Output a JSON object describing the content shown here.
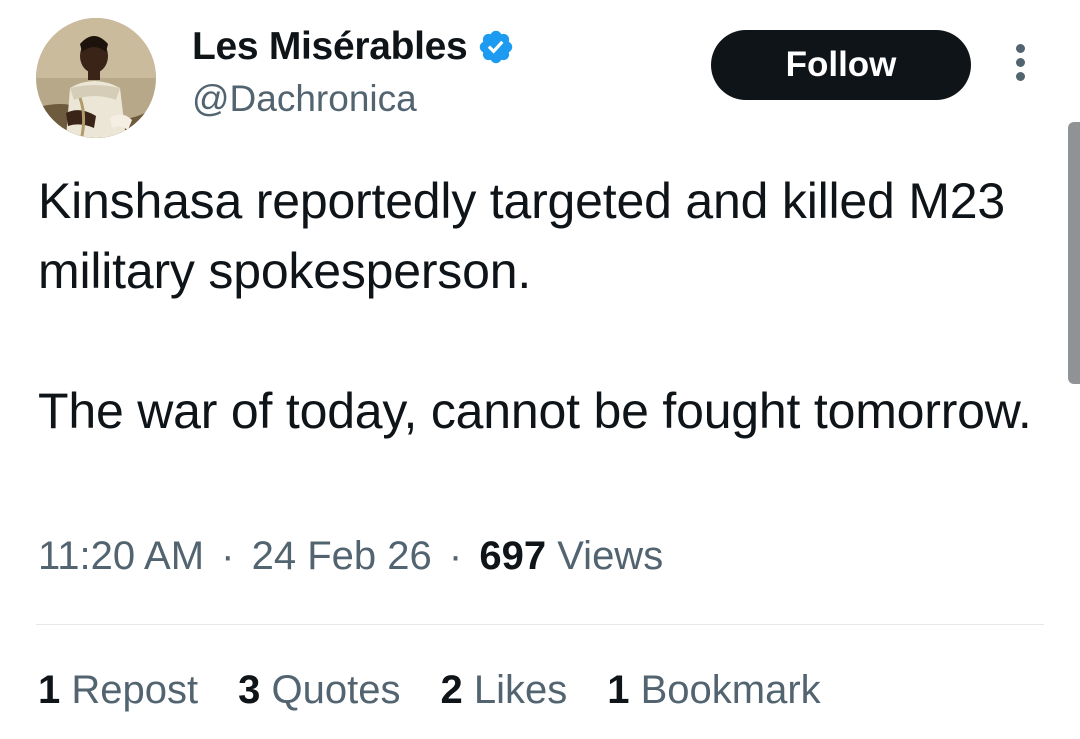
{
  "author": {
    "display_name": "Les Misérables",
    "handle": "@Dachronica",
    "avatar": "portrait-painting-avatar",
    "verified_icon": "verified-badge-icon",
    "verified_color": "#1d9bf0"
  },
  "actions": {
    "follow_label": "Follow",
    "more_icon": "more-options-icon"
  },
  "tweet": {
    "paragraphs": [
      "Kinshasa reportedly targeted and killed M23 military spokesperson.",
      "The war of today, cannot be fought tomorrow."
    ]
  },
  "meta": {
    "time": "11:20 AM",
    "separator": "·",
    "date": "24 Feb 26",
    "views_count": "697",
    "views_label": "Views"
  },
  "stats": {
    "reposts": {
      "count": "1",
      "label": "Repost"
    },
    "quotes": {
      "count": "3",
      "label": "Quotes"
    },
    "likes": {
      "count": "2",
      "label": "Likes"
    },
    "bookmarks": {
      "count": "1",
      "label": "Bookmark"
    }
  },
  "colors": {
    "text_primary": "#0f1419",
    "text_secondary": "#536471",
    "follow_button_bg": "#0f1419",
    "follow_button_text": "#ffffff"
  }
}
